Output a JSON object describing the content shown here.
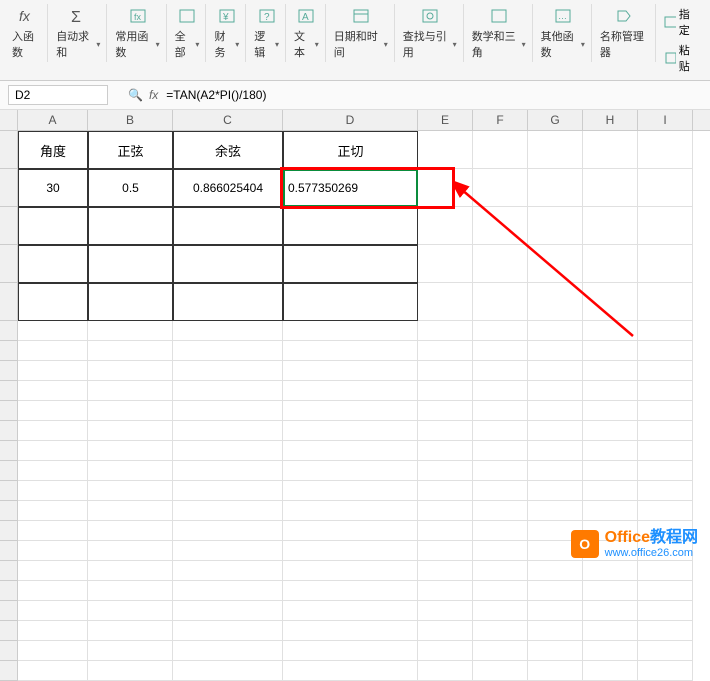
{
  "ribbon": {
    "insert_fn": "入函数",
    "autosum": "自动求和",
    "common": "常用函数",
    "all": "全部",
    "finance": "财务",
    "logic": "逻辑",
    "text": "文本",
    "datetime": "日期和时间",
    "lookup": "查找与引用",
    "math": "数学和三角",
    "other": "其他函数",
    "name_mgr": "名称管理器",
    "designate": "指定",
    "paste": "粘贴"
  },
  "namebox": {
    "cell_ref": "D2"
  },
  "formula": {
    "text": "=TAN(A2*PI()/180)"
  },
  "columns": [
    "A",
    "B",
    "C",
    "D",
    "E",
    "F",
    "G",
    "H",
    "I"
  ],
  "table": {
    "h_angle": "角度",
    "h_sin": "正弦",
    "h_cos": "余弦",
    "h_tan": "正切",
    "r1_angle": "30",
    "r1_sin": "0.5",
    "r1_cos": "0.866025404",
    "r1_tan": "0.577350269"
  },
  "watermark": {
    "title_a": "Office",
    "title_b": "教程网",
    "url": "www.office26.com"
  },
  "chart_data": {
    "type": "table",
    "title": "Trigonometric functions",
    "columns": [
      "角度",
      "正弦",
      "余弦",
      "正切"
    ],
    "rows": [
      {
        "角度": 30,
        "正弦": 0.5,
        "余弦": 0.866025404,
        "正切": 0.577350269
      }
    ]
  }
}
